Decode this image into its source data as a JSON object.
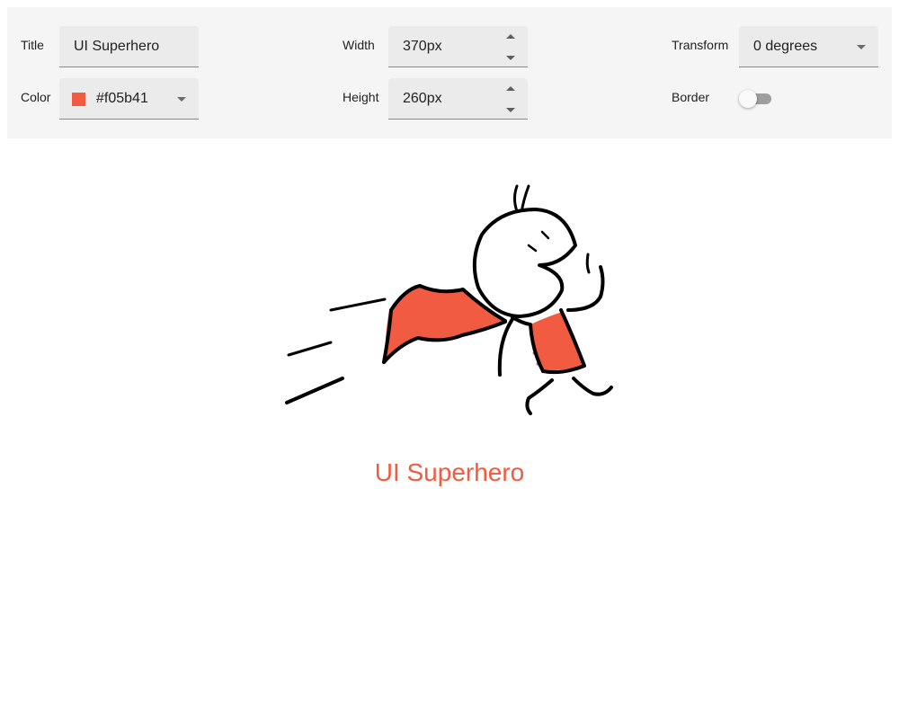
{
  "controls": {
    "title": {
      "label": "Title",
      "value": "UI Superhero"
    },
    "color": {
      "label": "Color",
      "value": "#f05b41"
    },
    "width": {
      "label": "Width",
      "value": "370px"
    },
    "height": {
      "label": "Height",
      "value": "260px"
    },
    "transform": {
      "label": "Transform",
      "value": "0 degrees"
    },
    "border": {
      "label": "Border",
      "enabled": false
    }
  },
  "preview": {
    "caption": "UI Superhero"
  },
  "colors": {
    "accent": "#f05b41",
    "panel": "#f5f5f5",
    "ink": "#000000"
  }
}
